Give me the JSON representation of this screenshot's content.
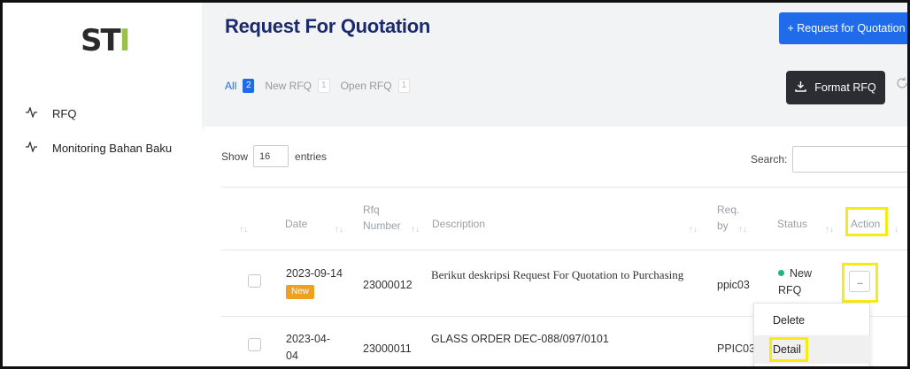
{
  "sidebar": {
    "logo_text_1": "ST",
    "logo_text_2": "I",
    "items": [
      {
        "label": "RFQ",
        "icon": "activity-icon"
      },
      {
        "label": "Monitoring Bahan Baku",
        "icon": "activity-icon"
      }
    ]
  },
  "header": {
    "title": "Request For Quotation",
    "primary_button": "+ Request for Quotation",
    "format_button": "Format RFQ",
    "tabs": [
      {
        "label": "All",
        "count": "2",
        "active": true
      },
      {
        "label": "New RFQ",
        "count": "1",
        "active": false
      },
      {
        "label": "Open RFQ",
        "count": "1",
        "active": false
      }
    ]
  },
  "table_controls": {
    "show_label": "Show",
    "entries_value": "16",
    "entries_label": "entries",
    "search_label": "Search:"
  },
  "table": {
    "columns": [
      "Date",
      "Rfq Number",
      "Description",
      "Req. by",
      "Status",
      "Action"
    ],
    "column_lines": {
      "rfq_1": "Rfq",
      "rfq_2": "Number",
      "req_1": "Req.",
      "req_2": "by"
    },
    "rows": [
      {
        "date": "2023-09-14",
        "tag": "New",
        "rfq_number": "23000012",
        "description": "Berikut deskripsi Request For Quotation to Purchasing",
        "req_by": "ppic03",
        "status_1": "New",
        "status_2": "RFQ",
        "action_label": "..."
      },
      {
        "date_1": "2023-04-",
        "date_2": "04",
        "rfq_number": "23000011",
        "description": "GLASS ORDER DEC-088/097/0101",
        "req_by": "PPIC03"
      }
    ]
  },
  "action_menu": {
    "items": [
      "Delete",
      "Detail"
    ]
  },
  "colors": {
    "title": "#1b2a6b",
    "primary": "#1f6bea",
    "dark_button": "#2b2d32",
    "new_tag": "#f0a020",
    "status_dot": "#1bb87a",
    "highlight": "#f7ec0f",
    "logo_accent": "#9bc04a"
  }
}
